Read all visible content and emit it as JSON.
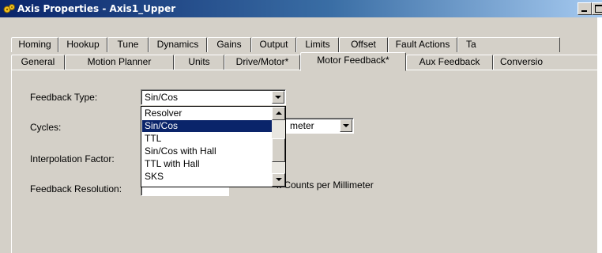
{
  "window": {
    "title": "Axis Properties - Axis1_Upper",
    "app_icon": "axis-properties-icon"
  },
  "tabs": {
    "back_row": [
      "Homing",
      "Hookup",
      "Tune",
      "Dynamics",
      "Gains",
      "Output",
      "Limits",
      "Offset",
      "Fault Actions",
      "Ta"
    ],
    "front_row": [
      "General",
      "Motion Planner",
      "Units",
      "Drive/Motor*",
      "Motor Feedback*",
      "Aux Feedback",
      "Conversio"
    ],
    "active": "Motor Feedback*"
  },
  "form": {
    "feedback_type": {
      "label": "Feedback Type:",
      "value": "Sin/Cos"
    },
    "cycles": {
      "label": "Cycles:",
      "unit_value": "meter"
    },
    "interpolation_factor": {
      "label": "Interpolation Factor:"
    },
    "feedback_resolution": {
      "label": "Feedback Resolution:",
      "unit_text": "k Counts per Millimeter"
    }
  },
  "dropdown_list": {
    "options": [
      "Resolver",
      "Sin/Cos",
      "TTL",
      "Sin/Cos with Hall",
      "TTL with Hall",
      "SKS"
    ],
    "selected": "Sin/Cos"
  },
  "colors": {
    "title_bar": "#0a246a",
    "selection": "#0a246a",
    "face": "#d4d0c8"
  }
}
